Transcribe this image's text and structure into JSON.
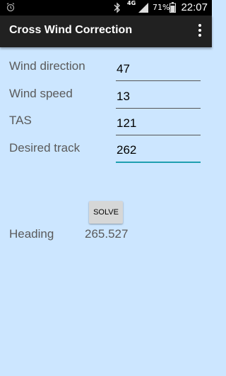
{
  "status_bar": {
    "network": "4G",
    "battery": "71%",
    "time": "22:07"
  },
  "action_bar": {
    "title": "Cross Wind Correction"
  },
  "form": {
    "wind_direction_label": "Wind direction",
    "wind_direction_value": "47",
    "wind_speed_label": "Wind speed",
    "wind_speed_value": "13",
    "tas_label": "TAS",
    "tas_value": "121",
    "desired_track_label": "Desired track",
    "desired_track_value": "262"
  },
  "solve_label": "SOLVE",
  "result": {
    "label": "Heading",
    "value": "265.527"
  },
  "colors": {
    "background": "#cce6ff",
    "action_bar": "#212121",
    "accent": "#1e9fb0"
  }
}
